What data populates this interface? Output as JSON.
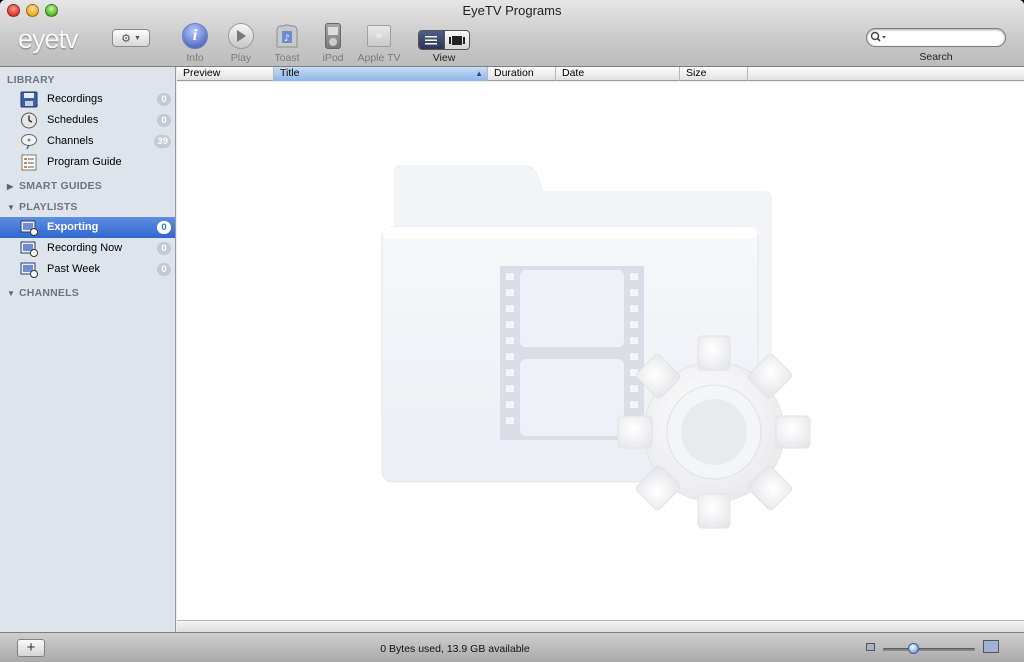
{
  "window": {
    "title": "EyeTV Programs",
    "brand": "eyetv"
  },
  "toolbar": {
    "items": [
      {
        "label": "Info",
        "icon": "info-icon"
      },
      {
        "label": "Play",
        "icon": "play-icon"
      },
      {
        "label": "Toast",
        "icon": "toast-icon"
      },
      {
        "label": "iPod",
        "icon": "ipod-icon"
      },
      {
        "label": "Apple TV",
        "icon": "apple-tv-icon"
      }
    ],
    "view_label": "View",
    "search_label": "Search",
    "search_placeholder": ""
  },
  "sidebar": {
    "library_header": "LIBRARY",
    "library": [
      {
        "label": "Recordings",
        "badge": "0"
      },
      {
        "label": "Schedules",
        "badge": "0"
      },
      {
        "label": "Channels",
        "badge": "39"
      },
      {
        "label": "Program Guide",
        "badge": ""
      }
    ],
    "smart_guides_header": "SMART GUIDES",
    "playlists_header": "PLAYLISTS",
    "playlists": [
      {
        "label": "Exporting",
        "badge": "0",
        "selected": true
      },
      {
        "label": "Recording Now",
        "badge": "0"
      },
      {
        "label": "Past Week",
        "badge": "0"
      }
    ],
    "channels_header": "CHANNELS"
  },
  "columns": [
    "Preview",
    "Title",
    "Duration",
    "Date",
    "Size"
  ],
  "status": {
    "text": "0 Bytes used, 13.9 GB available"
  },
  "colors": {
    "selection": "#3a6fd2",
    "sidebar": "#dde4ec"
  }
}
